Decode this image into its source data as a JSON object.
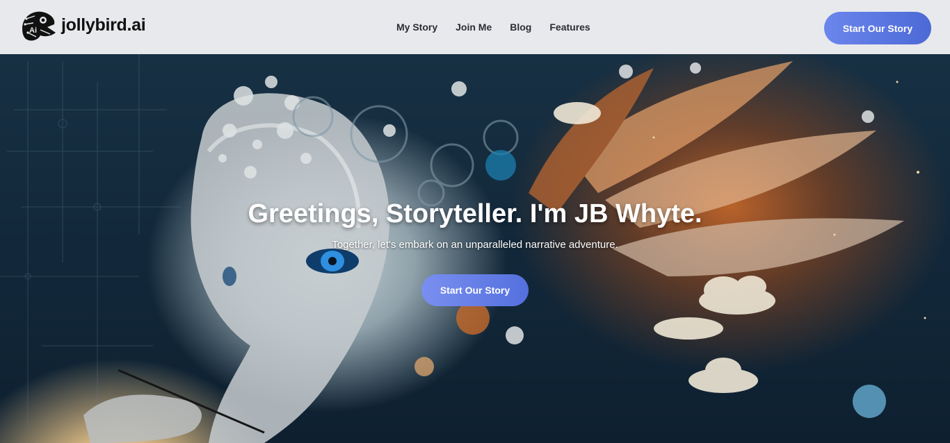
{
  "header": {
    "brand": "jollybird.ai",
    "logo_text": "Ai",
    "nav": [
      "My Story",
      "Join Me",
      "Blog",
      "Features"
    ],
    "cta_label": "Start Our Story"
  },
  "hero": {
    "title": "Greetings, Storyteller. I'm JB Whyte.",
    "subtitle": "Together, let's embark on an unparalleled narrative adventure.",
    "cta_label": "Start Our Story"
  },
  "colors": {
    "header_bg": "#e8e9ed",
    "cta_start": "#6b86ec",
    "cta_end": "#4c69d6"
  }
}
